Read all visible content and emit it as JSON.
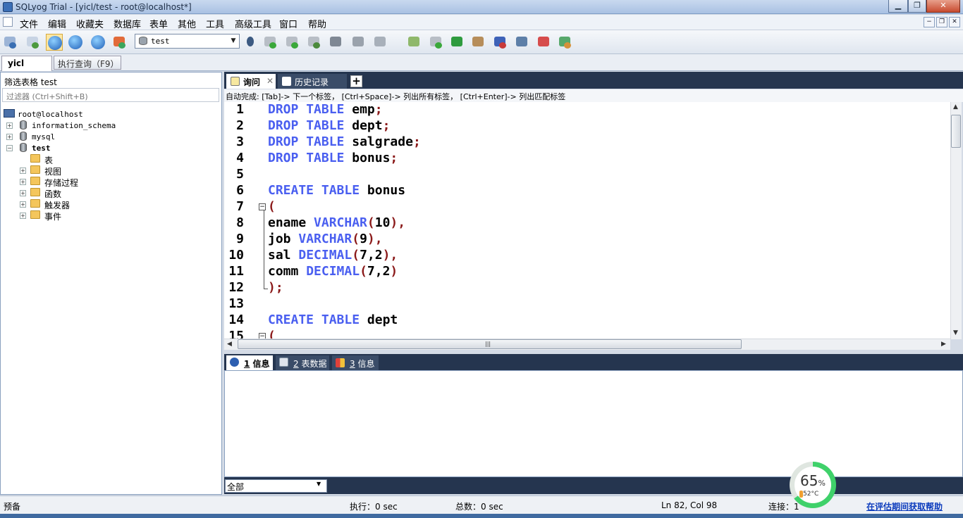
{
  "window": {
    "title": "SQLyog Trial - [yicl/test - root@localhost*]",
    "min": "▁",
    "max": "❐",
    "close": "✕"
  },
  "mdi": {
    "min": "−",
    "restore": "❐",
    "close": "✕"
  },
  "menu": [
    "文件",
    "编辑",
    "收藏夹",
    "数据库",
    "表单",
    "其他",
    "工具",
    "高级工具",
    "窗口",
    "帮助"
  ],
  "toolbar": {
    "database": "test",
    "arrow": "▼"
  },
  "connection": {
    "tab": "yicl",
    "execute_button": "执行查询（F9）"
  },
  "explorer": {
    "filter_label": "筛选表格 test",
    "filter_placeholder": "过滤器 (Ctrl+Shift+B)",
    "server": "root@localhost",
    "databases": [
      "information_schema",
      "mysql",
      "test"
    ],
    "nodes": [
      "表",
      "视图",
      "存储过程",
      "函数",
      "触发器",
      "事件"
    ],
    "plus": "+",
    "minus": "−"
  },
  "editor": {
    "tabs": {
      "query": "询问",
      "history": "历史记录",
      "add": "+"
    },
    "autocomplete": "自动完成: [Tab]-> 下一个标签， [Ctrl+Space]-> 列出所有标签， [Ctrl+Enter]-> 列出匹配标签",
    "line_numbers": [
      "1",
      "2",
      "3",
      "4",
      "5",
      "6",
      "7",
      "8",
      "9",
      "10",
      "11",
      "12",
      "13",
      "14",
      "15"
    ],
    "fold_marker": "−",
    "tokens": {
      "drop": "DROP",
      "create": "CREATE",
      "table": "TABLE",
      "varchar": "VARCHAR",
      "decimal": "DECIMAL",
      "emp": "emp",
      "dept": "dept",
      "salgrade": "salgrade",
      "bonus": "bonus",
      "ename": "ename",
      "job": "job",
      "sal": "sal",
      "comm": "comm",
      "semi": ";",
      "lparen": "(",
      "rparen": ")",
      "rparen_comma": "),",
      "rparen_semi": ");",
      "n10": "10",
      "n9": "9",
      "n72": "7,2"
    }
  },
  "results": {
    "tab1_num": "1",
    "tab1_label": " 信息",
    "tab2_num": "2",
    "tab2_label": " 表数据",
    "tab3_num": "3",
    "tab3_label": " 信息",
    "filter": "全部",
    "arrow": "▼"
  },
  "status": {
    "ready": "预备",
    "exec": "执行：0 sec",
    "total": "总数：0 sec",
    "position": "Ln 82, Col 98",
    "connections": "连接：1",
    "link": "在评估期间获取帮助"
  },
  "monitor": {
    "percent": "65",
    "unit": "%",
    "temp": "52°C"
  },
  "scroll": {
    "up": "▲",
    "down": "▼",
    "left": "◀",
    "right": "▶",
    "grip": "|||"
  },
  "colors": {
    "keyword": "#4a5ff0",
    "paren": "#8b1a1a",
    "panel_header": "#25354f",
    "gauge": "#3fd16a",
    "link": "#0b3bbd"
  }
}
